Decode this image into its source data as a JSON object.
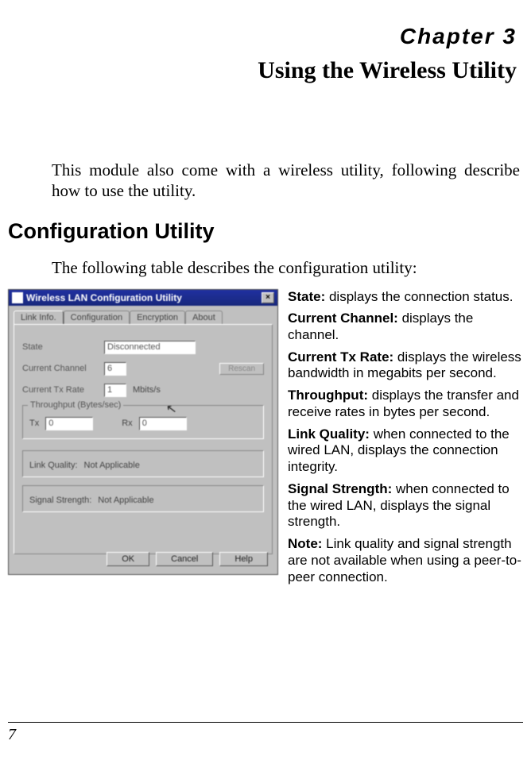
{
  "chapter_label": "Chapter 3",
  "chapter_title": "Using the Wireless Utility",
  "intro_text": "This module also come with a wireless utility, following describe how to use the utility.",
  "section_heading": "Configuration Utility",
  "section_intro": "The following table describes the configuration utility:",
  "dialog": {
    "title": "Wireless LAN Configuration Utility",
    "close": "×",
    "tabs": [
      "Link Info.",
      "Configuration",
      "Encryption",
      "About"
    ],
    "state_label": "State",
    "state_value": "Disconnected",
    "channel_label": "Current Channel",
    "channel_value": "6",
    "txrate_label": "Current Tx Rate",
    "txrate_value": "1",
    "txrate_unit": "Mbits/s",
    "rescan_btn": "Rescan",
    "throughput_label": "Throughput (Bytes/sec)",
    "tx_label": "Tx",
    "tx_value": "0",
    "rx_label": "Rx",
    "rx_value": "0",
    "link_quality_label": "Link Quality:",
    "link_quality_value": "Not Applicable",
    "signal_label": "Signal Strength:",
    "signal_value": "Not Applicable",
    "ok_btn": "OK",
    "cancel_btn": "Cancel",
    "help_btn": "Help"
  },
  "descriptions": {
    "state": {
      "label": "State:",
      "text": " displays the connection status."
    },
    "channel": {
      "label": "Current Channel:",
      "text": " displays the channel."
    },
    "txrate": {
      "label": "Current Tx Rate:",
      "text": " displays the wireless bandwidth in megabits per second."
    },
    "throughput": {
      "label": "Throughput:",
      "text": " displays the transfer and receive rates in bytes per second."
    },
    "link_quality": {
      "label": "Link Quality:",
      "text": " when connected to the wired LAN, displays the connection integrity."
    },
    "signal": {
      "label": "Signal Strength:",
      "text": " when connected to the wired LAN, displays the signal strength."
    },
    "note": {
      "label": "Note:",
      "text": " Link quality and signal strength are not available when using a peer-to-peer connection."
    }
  },
  "page_number": "7"
}
